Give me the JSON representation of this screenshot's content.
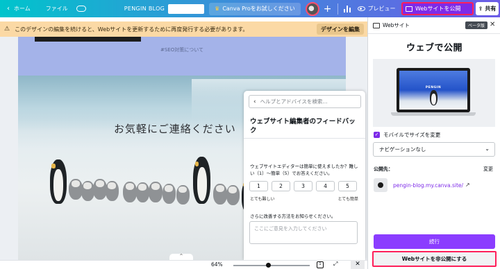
{
  "topbar": {
    "home_label": "ホーム",
    "file_label": "ファイル",
    "blog_title": "PENGIN BLOG",
    "pro_label": "Canva Proをお試しください",
    "preview_label": "プレビュー",
    "publish_label": "Webサイトを公開",
    "share_label": "共有"
  },
  "warning": {
    "message": "このデザインの編集を続けると、Webサイトを更新するために再度発行する必要があります。",
    "button_label": "デザインを編集"
  },
  "canvas": {
    "band_text": "#SEO対策について",
    "photo_text": "お気軽にご連絡ください"
  },
  "help_panel": {
    "search_placeholder": "ヘルプとアドバイスを検索...",
    "title": "ウェブサイト編集者のフィードバック",
    "question": "ウェブサイトエディターは簡単に使えましたか？難しい（1）～簡単（5）でお答えください。",
    "scale": [
      "1",
      "2",
      "3",
      "4",
      "5"
    ],
    "scale_low": "とても難しい",
    "scale_high": "とても簡単",
    "improve_label": "さらに改善する方法をお知らせください。",
    "textarea_placeholder": "ここにご意見を入力してください"
  },
  "bottombar": {
    "zoom": "64%",
    "page_num": "1",
    "caret": "^"
  },
  "side_panel": {
    "header": "Webサイト",
    "beta": "ベータ版",
    "title": "ウェブで公開",
    "thumb_text": "PENGIN",
    "mobile_resize": "モバイルでサイズを変更",
    "nav_select": "ナビゲーションなし",
    "publish_to_label": "公開先：",
    "change_label": "変更",
    "url": "pengin-blog.my.canva.site/",
    "continue_label": "続行",
    "unpublish_label": "Webサイトを非公開にする"
  },
  "colors": {
    "accent": "#7d2ae8",
    "highlight": "#ff1f5a",
    "warning_bg": "#fbd9a5"
  }
}
